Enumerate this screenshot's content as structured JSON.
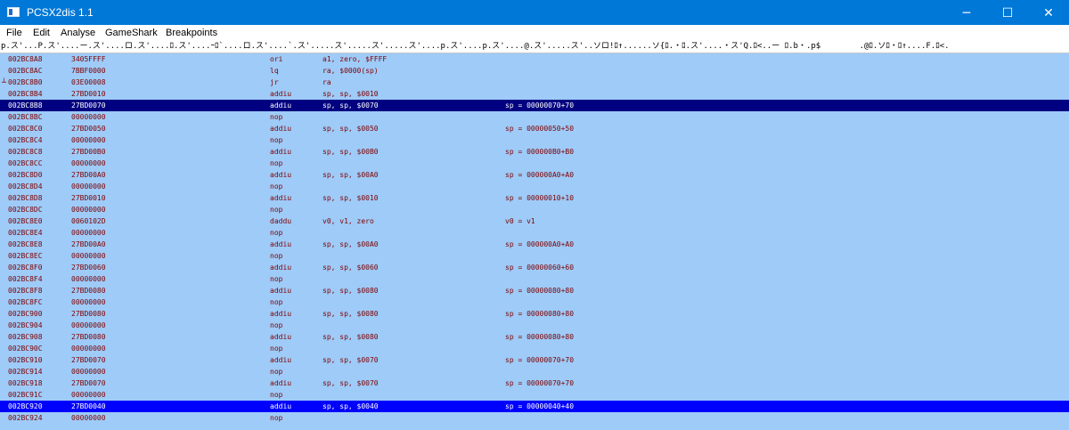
{
  "window": {
    "title": "PCSX2dis 1.1",
    "buttons": {
      "minimize": "─",
      "maximize": "☐",
      "close": "✕"
    },
    "titlebar_color": "#0078d7"
  },
  "menu": [
    "File",
    "Edit",
    "Analyse",
    "GameShark",
    "Breakpoints"
  ],
  "hexstrip": "p.ス'...P.ス'....ー.ス'....ロ.ス'....ﾛ.ス'....ｰﾛ`....ロ.ス'....`.ス'.....ス'.....ス'.....ス'....p.ス'....p.ス'....@.ス'.....ス'..ソロ!ﾛ↑......ソ{ﾛ.・ﾛ.ス'....・ス'Q.ﾛ<..ー ﾛ.b・.p$        .@ﾛ.ソﾛ・ﾛ↑....F.ﾛ<.",
  "colors": {
    "listing_bg": "#9ecbf8",
    "text": "#800000",
    "selection_dark": "#000080",
    "selection_blue": "#0000ff"
  },
  "listing": [
    {
      "addr": "002BC8A8",
      "hex": "3405FFFF",
      "op": "ori",
      "args": "a1, zero, $FFFF",
      "comment": ""
    },
    {
      "addr": "002BC8AC",
      "hex": "7BBF0000",
      "op": "lq",
      "args": "ra, $0000(sp)",
      "comment": ""
    },
    {
      "addr": "002BC8B0",
      "hex": "03E00008",
      "op": "jr",
      "args": "ra",
      "comment": "",
      "mark": "┴"
    },
    {
      "addr": "002BC8B4",
      "hex": "27BD0010",
      "op": "addiu",
      "args": "sp, sp, $0010",
      "comment": ""
    },
    {
      "addr": "002BC8B8",
      "hex": "27BD0070",
      "op": "addiu",
      "args": "sp, sp, $0070",
      "comment": "sp = 00000070+70",
      "selected": "dark"
    },
    {
      "addr": "002BC8BC",
      "hex": "00000000",
      "op": "nop",
      "args": "",
      "comment": ""
    },
    {
      "addr": "002BC8C0",
      "hex": "27BD0050",
      "op": "addiu",
      "args": "sp, sp, $0050",
      "comment": "sp = 00000050+50"
    },
    {
      "addr": "002BC8C4",
      "hex": "00000000",
      "op": "nop",
      "args": "",
      "comment": ""
    },
    {
      "addr": "002BC8C8",
      "hex": "27BD00B0",
      "op": "addiu",
      "args": "sp, sp, $00B0",
      "comment": "sp = 000000B0+B0"
    },
    {
      "addr": "002BC8CC",
      "hex": "00000000",
      "op": "nop",
      "args": "",
      "comment": ""
    },
    {
      "addr": "002BC8D0",
      "hex": "27BD00A0",
      "op": "addiu",
      "args": "sp, sp, $00A0",
      "comment": "sp = 000000A0+A0"
    },
    {
      "addr": "002BC8D4",
      "hex": "00000000",
      "op": "nop",
      "args": "",
      "comment": ""
    },
    {
      "addr": "002BC8D8",
      "hex": "27BD0010",
      "op": "addiu",
      "args": "sp, sp, $0010",
      "comment": "sp = 00000010+10"
    },
    {
      "addr": "002BC8DC",
      "hex": "00000000",
      "op": "nop",
      "args": "",
      "comment": ""
    },
    {
      "addr": "002BC8E0",
      "hex": "0060102D",
      "op": "daddu",
      "args": "v0, v1, zero",
      "comment": "v0 = v1"
    },
    {
      "addr": "002BC8E4",
      "hex": "00000000",
      "op": "nop",
      "args": "",
      "comment": ""
    },
    {
      "addr": "002BC8E8",
      "hex": "27BD00A0",
      "op": "addiu",
      "args": "sp, sp, $00A0",
      "comment": "sp = 000000A0+A0"
    },
    {
      "addr": "002BC8EC",
      "hex": "00000000",
      "op": "nop",
      "args": "",
      "comment": ""
    },
    {
      "addr": "002BC8F0",
      "hex": "27BD0060",
      "op": "addiu",
      "args": "sp, sp, $0060",
      "comment": "sp = 00000060+60"
    },
    {
      "addr": "002BC8F4",
      "hex": "00000000",
      "op": "nop",
      "args": "",
      "comment": ""
    },
    {
      "addr": "002BC8F8",
      "hex": "27BD0080",
      "op": "addiu",
      "args": "sp, sp, $0080",
      "comment": "sp = 00000080+80"
    },
    {
      "addr": "002BC8FC",
      "hex": "00000000",
      "op": "nop",
      "args": "",
      "comment": ""
    },
    {
      "addr": "002BC900",
      "hex": "27BD0080",
      "op": "addiu",
      "args": "sp, sp, $0080",
      "comment": "sp = 00000080+80"
    },
    {
      "addr": "002BC904",
      "hex": "00000000",
      "op": "nop",
      "args": "",
      "comment": ""
    },
    {
      "addr": "002BC908",
      "hex": "27BD0080",
      "op": "addiu",
      "args": "sp, sp, $0080",
      "comment": "sp = 00000080+80"
    },
    {
      "addr": "002BC90C",
      "hex": "00000000",
      "op": "nop",
      "args": "",
      "comment": ""
    },
    {
      "addr": "002BC910",
      "hex": "27BD0070",
      "op": "addiu",
      "args": "sp, sp, $0070",
      "comment": "sp = 00000070+70"
    },
    {
      "addr": "002BC914",
      "hex": "00000000",
      "op": "nop",
      "args": "",
      "comment": ""
    },
    {
      "addr": "002BC918",
      "hex": "27BD0070",
      "op": "addiu",
      "args": "sp, sp, $0070",
      "comment": "sp = 00000070+70"
    },
    {
      "addr": "002BC91C",
      "hex": "00000000",
      "op": "nop",
      "args": "",
      "comment": ""
    },
    {
      "addr": "002BC920",
      "hex": "27BD0040",
      "op": "addiu",
      "args": "sp, sp, $0040",
      "comment": "sp = 00000040+40",
      "selected": "blue"
    },
    {
      "addr": "002BC924",
      "hex": "00000000",
      "op": "nop",
      "args": "",
      "comment": ""
    }
  ]
}
